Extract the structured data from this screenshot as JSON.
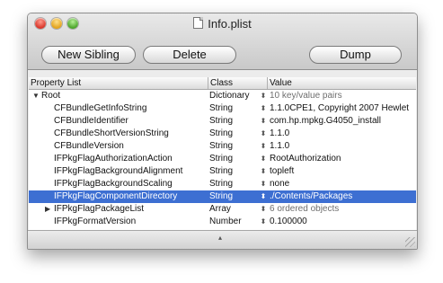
{
  "window": {
    "title": "Info.plist"
  },
  "toolbar": {
    "new_sibling": "New Sibling",
    "delete": "Delete",
    "dump": "Dump"
  },
  "columns": {
    "property_list": "Property List",
    "class": "Class",
    "value": "Value"
  },
  "rows": [
    {
      "key": "Root",
      "class": "Dictionary",
      "value": "10 key/value pairs",
      "expanded": true,
      "depth": 0,
      "value_readonly": true
    },
    {
      "key": "CFBundleGetInfoString",
      "class": "String",
      "value": "1.1.0CPE1, Copyright 2007 Hewlet",
      "depth": 1
    },
    {
      "key": "CFBundleIdentifier",
      "class": "String",
      "value": "com.hp.mpkg.G4050_install",
      "depth": 1
    },
    {
      "key": "CFBundleShortVersionString",
      "class": "String",
      "value": "1.1.0",
      "depth": 1
    },
    {
      "key": "CFBundleVersion",
      "class": "String",
      "value": "1.1.0",
      "depth": 1
    },
    {
      "key": "IFPkgFlagAuthorizationAction",
      "class": "String",
      "value": "RootAuthorization",
      "depth": 1
    },
    {
      "key": "IFPkgFlagBackgroundAlignment",
      "class": "String",
      "value": "topleft",
      "depth": 1
    },
    {
      "key": "IFPkgFlagBackgroundScaling",
      "class": "String",
      "value": "none",
      "depth": 1
    },
    {
      "key": "IFPkgFlagComponentDirectory",
      "class": "String",
      "value": "./Contents/Packages",
      "depth": 1,
      "selected": true
    },
    {
      "key": "IFPkgFlagPackageList",
      "class": "Array",
      "value": "6 ordered objects",
      "depth": 1,
      "collapsed": true,
      "value_readonly": true
    },
    {
      "key": "IFPkgFormatVersion",
      "class": "Number",
      "value": "0.100000",
      "depth": 1
    }
  ],
  "icons": {
    "close": "close-icon",
    "minimize": "minimize-icon",
    "zoom": "zoom-icon",
    "document": "document-icon",
    "stepper": "stepper-icon",
    "disclosure_open": "disclosure-open-icon",
    "disclosure_closed": "disclosure-closed-icon",
    "resize": "resize-grip-icon"
  },
  "colors": {
    "selection": "#3d6fd2",
    "traffic_close": "#d9362a",
    "traffic_min": "#e2a21c",
    "traffic_zoom": "#4ba42a"
  }
}
